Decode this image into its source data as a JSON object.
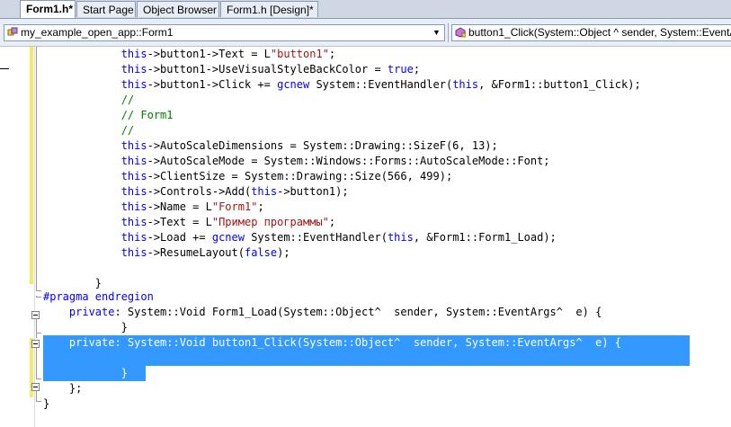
{
  "tabs": [
    {
      "label": "Form1.h*",
      "active": true
    },
    {
      "label": "Start Page",
      "active": false
    },
    {
      "label": "Object Browser",
      "active": false
    },
    {
      "label": "Form1.h [Design]*",
      "active": false
    }
  ],
  "nav": {
    "class_combo": "my_example_open_app::Form1",
    "member_combo": "button1_Click(System::Object ^ sender, System::EventA"
  },
  "code_lines": [
    {
      "indent": "            ",
      "tokens": [
        [
          "kw",
          "this"
        ],
        [
          "t",
          "->button1->Text = L"
        ],
        [
          "st",
          "\"button1\""
        ],
        [
          "t",
          ";"
        ]
      ]
    },
    {
      "indent": "            ",
      "tokens": [
        [
          "kw",
          "this"
        ],
        [
          "t",
          "->button1->UseVisualStyleBackColor = "
        ],
        [
          "kw",
          "true"
        ],
        [
          "t",
          ";"
        ]
      ]
    },
    {
      "indent": "            ",
      "tokens": [
        [
          "kw",
          "this"
        ],
        [
          "t",
          "->button1->Click += "
        ],
        [
          "kw",
          "gcnew"
        ],
        [
          "t",
          " System::EventHandler("
        ],
        [
          "kw",
          "this"
        ],
        [
          "t",
          ", &Form1::button1_Click);"
        ]
      ]
    },
    {
      "indent": "            ",
      "tokens": [
        [
          "cm",
          "//"
        ]
      ]
    },
    {
      "indent": "            ",
      "tokens": [
        [
          "cm",
          "// Form1"
        ]
      ]
    },
    {
      "indent": "            ",
      "tokens": [
        [
          "cm",
          "//"
        ]
      ]
    },
    {
      "indent": "            ",
      "tokens": [
        [
          "kw",
          "this"
        ],
        [
          "t",
          "->AutoScaleDimensions = System::Drawing::SizeF(6, 13);"
        ]
      ]
    },
    {
      "indent": "            ",
      "tokens": [
        [
          "kw",
          "this"
        ],
        [
          "t",
          "->AutoScaleMode = System::Windows::Forms::AutoScaleMode::Font;"
        ]
      ]
    },
    {
      "indent": "            ",
      "tokens": [
        [
          "kw",
          "this"
        ],
        [
          "t",
          "->ClientSize = System::Drawing::Size(566, 499);"
        ]
      ]
    },
    {
      "indent": "            ",
      "tokens": [
        [
          "kw",
          "this"
        ],
        [
          "t",
          "->Controls->Add("
        ],
        [
          "kw",
          "this"
        ],
        [
          "t",
          "->button1);"
        ]
      ]
    },
    {
      "indent": "            ",
      "tokens": [
        [
          "kw",
          "this"
        ],
        [
          "t",
          "->Name = L"
        ],
        [
          "st",
          "\"Form1\""
        ],
        [
          "t",
          ";"
        ]
      ]
    },
    {
      "indent": "            ",
      "tokens": [
        [
          "kw",
          "this"
        ],
        [
          "t",
          "->Text = L"
        ],
        [
          "st",
          "\"Пример программы\""
        ],
        [
          "t",
          ";"
        ]
      ]
    },
    {
      "indent": "            ",
      "tokens": [
        [
          "kw",
          "this"
        ],
        [
          "t",
          "->Load += "
        ],
        [
          "kw",
          "gcnew"
        ],
        [
          "t",
          " System::EventHandler("
        ],
        [
          "kw",
          "this"
        ],
        [
          "t",
          ", &Form1::Form1_Load);"
        ]
      ]
    },
    {
      "indent": "            ",
      "tokens": [
        [
          "kw",
          "this"
        ],
        [
          "t",
          "->ResumeLayout("
        ],
        [
          "kw",
          "false"
        ],
        [
          "t",
          ");"
        ]
      ]
    },
    {
      "indent": "",
      "tokens": []
    },
    {
      "indent": "        ",
      "tokens": [
        [
          "t",
          "}"
        ]
      ]
    },
    {
      "indent": "",
      "tokens": [
        [
          "kw",
          "#pragma endregion"
        ]
      ]
    },
    {
      "indent": "    ",
      "tokens": [
        [
          "kw",
          "private"
        ],
        [
          "t",
          ": System::Void Form1_Load(System::Object^  sender, System::EventArgs^  e) {"
        ]
      ]
    },
    {
      "indent": "            ",
      "tokens": [
        [
          "t",
          "}"
        ]
      ]
    },
    {
      "indent": "    ",
      "tokens": [
        [
          "kw",
          "private"
        ],
        [
          "t",
          ": System::Void button1_Click(System::Object^  sender, System::EventArgs^  e) {"
        ]
      ],
      "selected": true
    },
    {
      "indent": "",
      "tokens": [],
      "selected": true
    },
    {
      "indent": "            ",
      "tokens": [
        [
          "t",
          "}"
        ]
      ],
      "selected": true
    },
    {
      "indent": "    ",
      "tokens": [
        [
          "t",
          "};"
        ]
      ]
    },
    {
      "indent": "",
      "tokens": [
        [
          "t",
          "}"
        ]
      ]
    }
  ],
  "colors": {
    "keyword": "#0000ff",
    "comment": "#008000",
    "string": "#a31515",
    "selection": "#3399ff"
  }
}
